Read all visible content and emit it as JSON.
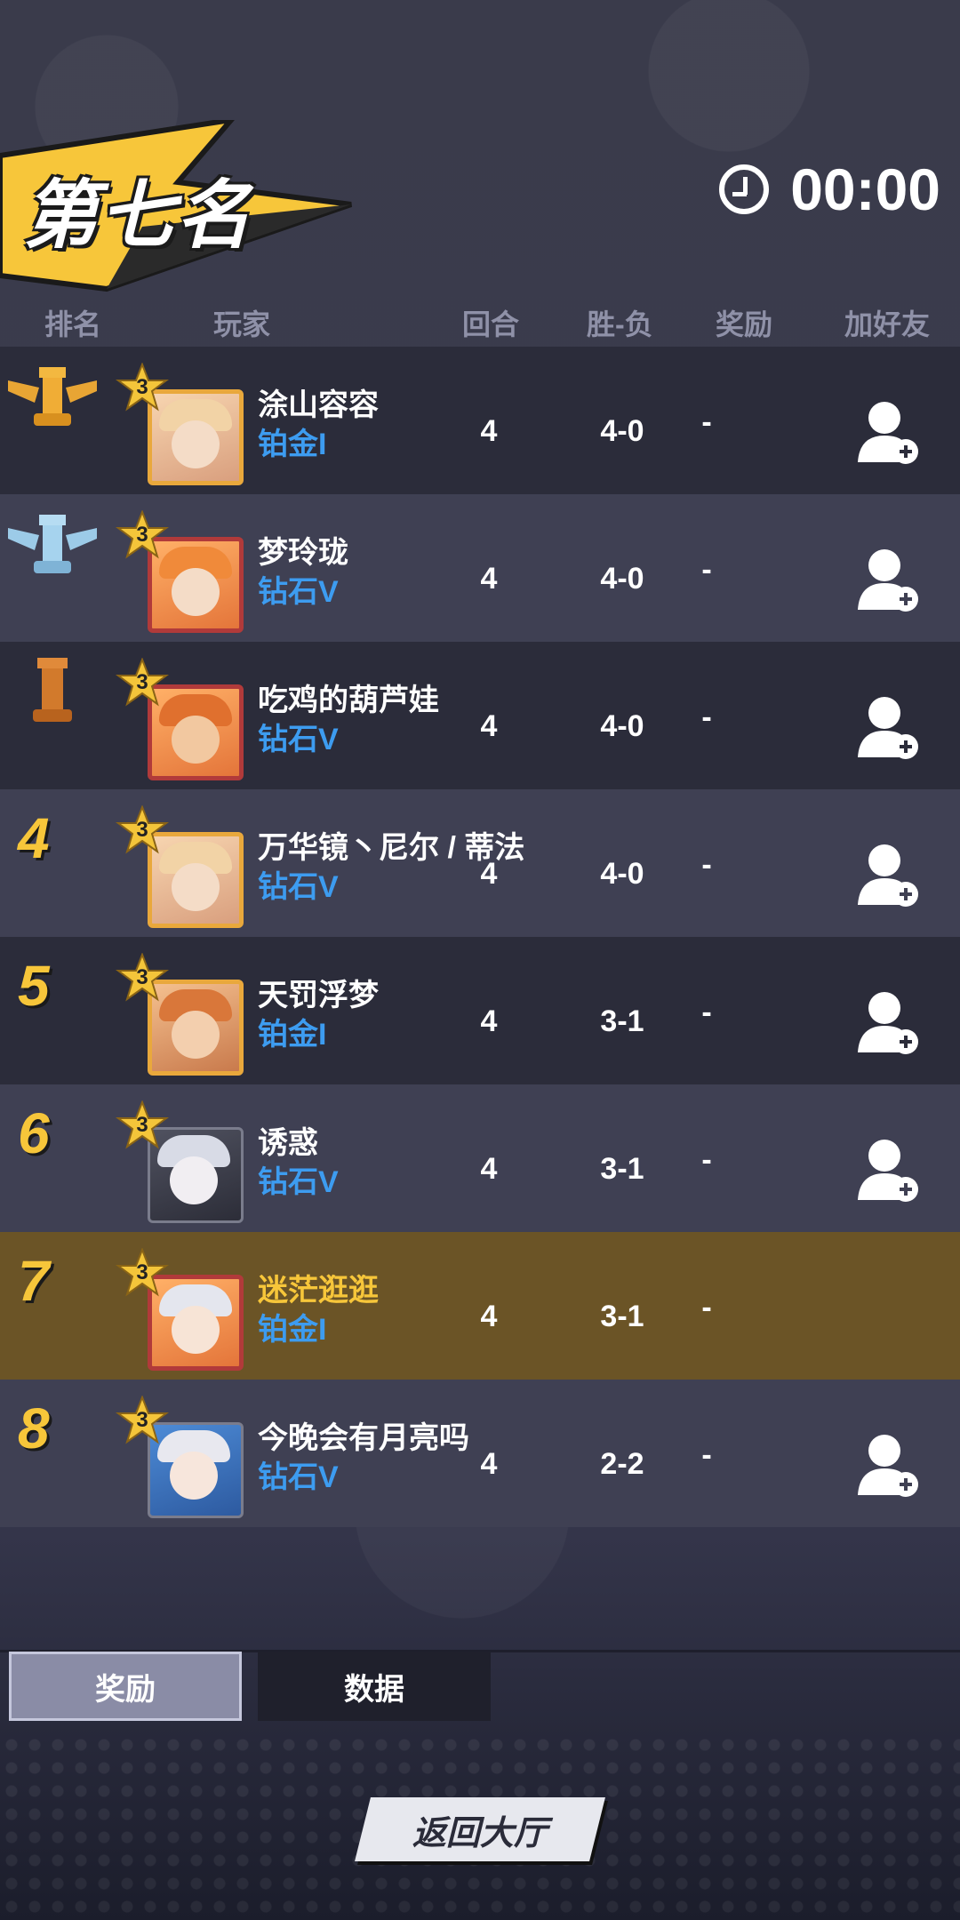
{
  "header": {
    "rank_title": "第七名",
    "timer": "00:00"
  },
  "columns": {
    "rank": "排名",
    "player": "玩家",
    "rounds": "回合",
    "record": "胜-负",
    "reward": "奖励",
    "add_friend": "加好友"
  },
  "rows": [
    {
      "rank": "1",
      "medal": "gold",
      "star": "3",
      "name": "涂山容容",
      "tier": "铂金I",
      "rounds": "4",
      "record": "4-0",
      "reward": "-",
      "self": false
    },
    {
      "rank": "2",
      "medal": "silver",
      "star": "3",
      "name": "梦玲珑",
      "tier": "钻石V",
      "rounds": "4",
      "record": "4-0",
      "reward": "-",
      "self": false
    },
    {
      "rank": "3",
      "medal": "bronze",
      "star": "3",
      "name": "吃鸡的葫芦娃",
      "tier": "钻石V",
      "rounds": "4",
      "record": "4-0",
      "reward": "-",
      "self": false
    },
    {
      "rank": "4",
      "star": "3",
      "name": "万华镜丶尼尔 / 蒂法",
      "tier": "钻石V",
      "rounds": "4",
      "record": "4-0",
      "reward": "-",
      "self": false
    },
    {
      "rank": "5",
      "star": "3",
      "name": "天罚浮梦",
      "tier": "铂金I",
      "rounds": "4",
      "record": "3-1",
      "reward": "-",
      "self": false
    },
    {
      "rank": "6",
      "star": "3",
      "name": "诱惑",
      "tier": "钻石V",
      "rounds": "4",
      "record": "3-1",
      "reward": "-",
      "self": false
    },
    {
      "rank": "7",
      "star": "3",
      "name": "迷茫逛逛",
      "tier": "铂金I",
      "rounds": "4",
      "record": "3-1",
      "reward": "-",
      "self": true
    },
    {
      "rank": "8",
      "star": "3",
      "name": "今晚会有月亮吗",
      "tier": "钻石V",
      "rounds": "4",
      "record": "2-2",
      "reward": "-",
      "self": false
    }
  ],
  "tabs": {
    "rewards": "奖励",
    "data": "数据"
  },
  "back_button": "返回大厅",
  "colors": {
    "gold_accent": "#f7c63a",
    "tier_blue": "#3d9cf0",
    "self_row": "#6b5426"
  }
}
